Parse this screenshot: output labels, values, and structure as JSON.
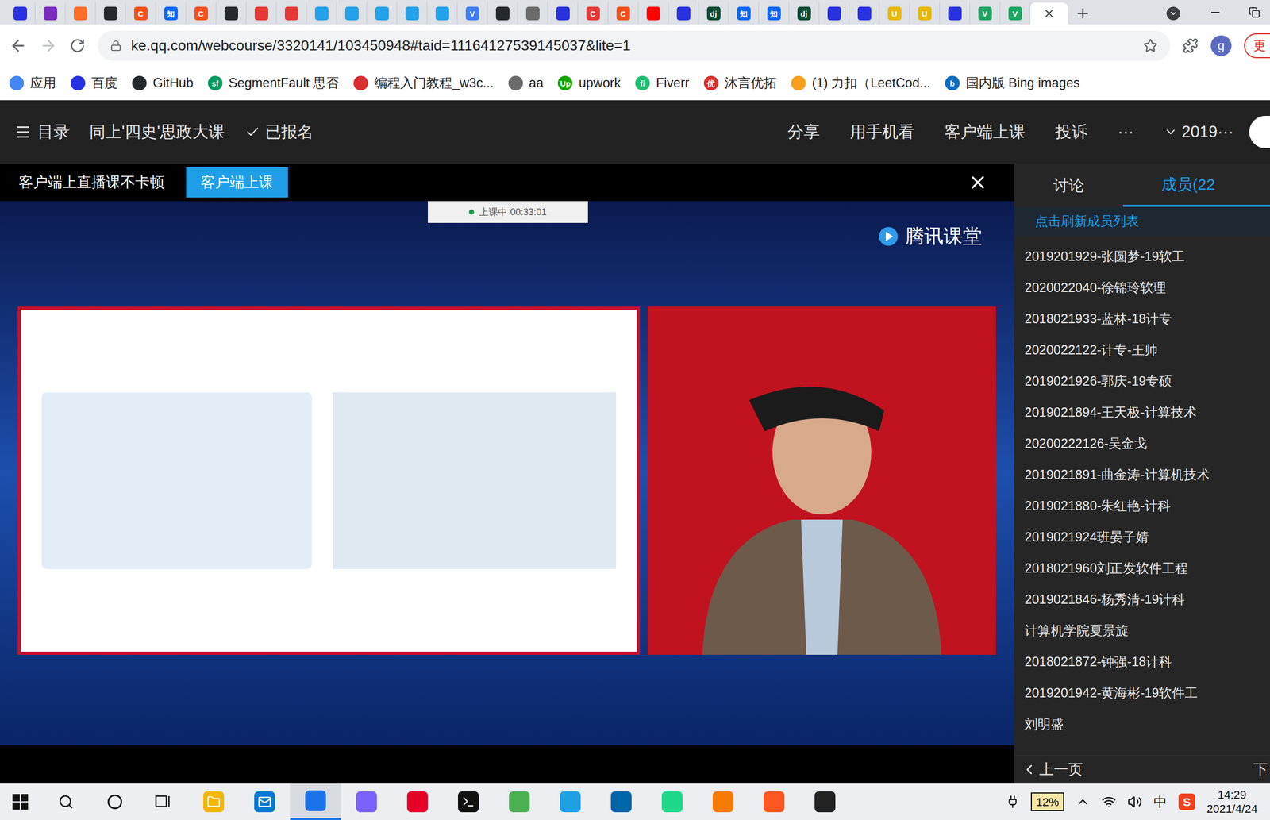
{
  "browser": {
    "tabs": [
      {
        "glyph": "",
        "color": "#2932e1",
        "selected": false
      },
      {
        "glyph": "",
        "color": "#7b2cbf",
        "selected": false
      },
      {
        "glyph": "",
        "color": "#fc6d26",
        "selected": false
      },
      {
        "glyph": "",
        "color": "#24292e",
        "selected": false
      },
      {
        "glyph": "C",
        "color": "#f4511e",
        "selected": false
      },
      {
        "glyph": "知",
        "color": "#0a66ff",
        "selected": false
      },
      {
        "glyph": "C",
        "color": "#f4511e",
        "selected": false
      },
      {
        "glyph": "",
        "color": "#24292e",
        "selected": false
      },
      {
        "glyph": "",
        "color": "#e53935",
        "selected": false
      },
      {
        "glyph": "",
        "color": "#e53935",
        "selected": false
      },
      {
        "glyph": "",
        "color": "#23a1ea",
        "selected": false
      },
      {
        "glyph": "",
        "color": "#23a1ea",
        "selected": false
      },
      {
        "glyph": "",
        "color": "#23a1ea",
        "selected": false
      },
      {
        "glyph": "",
        "color": "#23a1ea",
        "selected": false
      },
      {
        "glyph": "",
        "color": "#23a1ea",
        "selected": false
      },
      {
        "glyph": "V",
        "color": "#3f7ef5",
        "selected": false
      },
      {
        "glyph": "",
        "color": "#24292e",
        "selected": false
      },
      {
        "glyph": "",
        "color": "#6b6b6b",
        "selected": false
      },
      {
        "glyph": "",
        "color": "#2932e1",
        "selected": false
      },
      {
        "glyph": "C",
        "color": "#e53935",
        "selected": false
      },
      {
        "glyph": "C",
        "color": "#f4511e",
        "selected": false
      },
      {
        "glyph": "",
        "color": "#ff0000",
        "selected": false
      },
      {
        "glyph": "",
        "color": "#2932e1",
        "selected": false
      },
      {
        "glyph": "dj",
        "color": "#0c4b33",
        "selected": false
      },
      {
        "glyph": "知",
        "color": "#0a66ff",
        "selected": false
      },
      {
        "glyph": "知",
        "color": "#0a66ff",
        "selected": false
      },
      {
        "glyph": "dj",
        "color": "#0c4b33",
        "selected": false
      },
      {
        "glyph": "",
        "color": "#2932e1",
        "selected": false
      },
      {
        "glyph": "",
        "color": "#2932e1",
        "selected": false
      },
      {
        "glyph": "U",
        "color": "#e6b800",
        "selected": false
      },
      {
        "glyph": "U",
        "color": "#e6b800",
        "selected": false
      },
      {
        "glyph": "",
        "color": "#2932e1",
        "selected": false
      },
      {
        "glyph": "V",
        "color": "#1fa463",
        "selected": false
      },
      {
        "glyph": "V",
        "color": "#1fa463",
        "selected": false
      },
      {
        "glyph": "",
        "color": "#ffffff",
        "selected": true
      }
    ],
    "address": "ke.qq.com/webcourse/3320141/103450948#taid=11164127539145037&lite=1",
    "profile": "g",
    "update": "更"
  },
  "bookmarks": [
    {
      "label": "应用",
      "glyph": "",
      "color": "#4285f4"
    },
    {
      "label": "百度",
      "glyph": "",
      "color": "#2932e1"
    },
    {
      "label": "GitHub",
      "glyph": "",
      "color": "#24292e"
    },
    {
      "label": "SegmentFault 思否",
      "glyph": "sf",
      "color": "#009a61"
    },
    {
      "label": "编程入门教程_w3c...",
      "glyph": "",
      "color": "#d92e2e"
    },
    {
      "label": "aa",
      "glyph": "",
      "color": "#6b6b6b"
    },
    {
      "label": "upwork",
      "glyph": "Up",
      "color": "#14a800"
    },
    {
      "label": "Fiverr",
      "glyph": "fi",
      "color": "#1dbf73"
    },
    {
      "label": "沐言优拓",
      "glyph": "优",
      "color": "#d92e2e"
    },
    {
      "label": "(1) 力扣（LeetCod...",
      "glyph": "",
      "color": "#f89f1b"
    },
    {
      "label": "国内版 Bing images",
      "glyph": "b",
      "color": "#0f6cbd"
    }
  ],
  "header": {
    "catalog": "目录",
    "course_title": "同上'四史'思政大课",
    "enrolled": "已报名",
    "actions": [
      "分享",
      "用手机看",
      "客户端上课",
      "投诉",
      "···"
    ],
    "term": "2019···"
  },
  "banner": {
    "text": "客户端上直播课不卡顿",
    "button": "客户端上课"
  },
  "video": {
    "status": "上课中 00:33:01",
    "logo": "腾讯课堂"
  },
  "side_panel": {
    "tabs": [
      {
        "label": "讨论",
        "selected": false
      },
      {
        "label": "成员(22",
        "selected": true
      }
    ],
    "refresh": "点击刷新成员列表",
    "members": [
      "2019201929-张圆梦-19软工",
      "2020022040-徐锦玲软理",
      "2018021933-蓝林-18计专",
      "2020022122-计专-王帅",
      "2019021926-郭庆-19专硕",
      "2019021894-王天极-计算技术",
      "20200222126-吴金戈",
      "2019021891-曲金涛-计算机技术",
      "2019021880-朱红艳-计科",
      "2019021924班晏子婧",
      "2018021960刘正发软件工程",
      "2019021846-杨秀清-19计科",
      "计算机学院夏景旋",
      "2018021872-钟强-18计科",
      "2019201942-黄海彬-19软件工",
      "刘明盛"
    ],
    "prev": "上一页",
    "next": "下"
  },
  "taskbar": {
    "apps": [
      {
        "color": "#f2b705",
        "active": false
      },
      {
        "color": "#0078d4",
        "active": false
      },
      {
        "color": "#1a73e8",
        "active": true
      },
      {
        "color": "#7b61ff",
        "active": false
      },
      {
        "color": "#e60026",
        "active": false
      },
      {
        "color": "#111111",
        "active": false
      },
      {
        "color": "#4caf50",
        "active": false
      },
      {
        "color": "#1fa0e3",
        "active": false
      },
      {
        "color": "#0065a9",
        "active": false
      },
      {
        "color": "#21d789",
        "active": false
      },
      {
        "color": "#f57c00",
        "active": false
      },
      {
        "color": "#ff5722",
        "active": false
      },
      {
        "color": "#222222",
        "active": false
      }
    ],
    "battery": "12%",
    "ime": "中",
    "sogou": "S",
    "time": "14:29",
    "date": "2021/4/24"
  }
}
